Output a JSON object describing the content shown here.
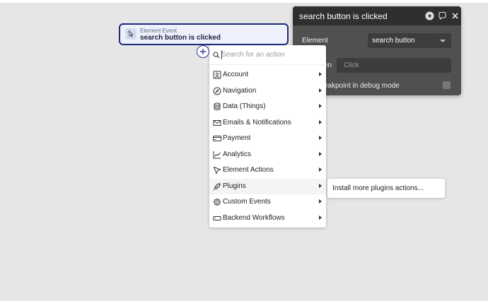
{
  "event_card": {
    "type_label": "Element Event",
    "name": "search button is clicked"
  },
  "panel": {
    "title": "search button is clicked",
    "element_label": "Element",
    "element_value": "search button",
    "event_label": "en",
    "event_placeholder": "Click",
    "breakpoint_label": "eakpoint in debug mode"
  },
  "menu": {
    "search_placeholder": "Search for an action",
    "items": [
      {
        "label": "Account",
        "icon": "account-icon"
      },
      {
        "label": "Navigation",
        "icon": "compass-icon"
      },
      {
        "label": "Data (Things)",
        "icon": "database-icon"
      },
      {
        "label": "Emails & Notifications",
        "icon": "envelope-icon"
      },
      {
        "label": "Payment",
        "icon": "credit-card-icon"
      },
      {
        "label": "Analytics",
        "icon": "line-chart-icon"
      },
      {
        "label": "Element Actions",
        "icon": "cursor-icon"
      },
      {
        "label": "Plugins",
        "icon": "plug-icon"
      },
      {
        "label": "Custom Events",
        "icon": "cog-icon"
      },
      {
        "label": "Backend Workflows",
        "icon": "server-icon"
      }
    ],
    "hovered_item": "Plugins"
  },
  "submenu": {
    "label": "Install more plugins actions..."
  },
  "colors": {
    "canvas": "#e6e6e6",
    "accent": "#1e2a7a",
    "panel_bg": "#505050",
    "panel_header": "#2f2f2f"
  }
}
